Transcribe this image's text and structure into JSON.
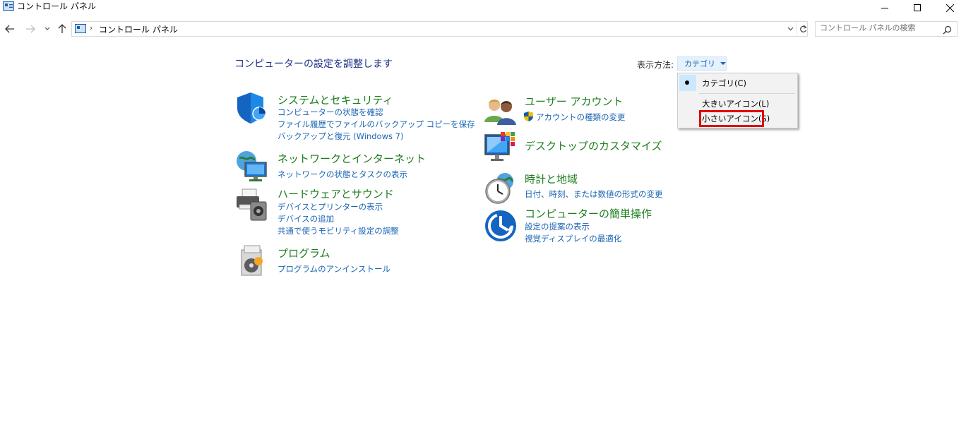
{
  "window": {
    "title": "コントロール パネル",
    "icons": {
      "app": "control-panel-icon",
      "minimize": "minimize-icon",
      "maximize": "maximize-icon",
      "close": "close-icon"
    }
  },
  "nav": {
    "icons": {
      "back": "back-arrow-icon",
      "forward": "forward-arrow-icon",
      "recent": "chevron-down-icon",
      "up": "up-arrow-icon",
      "refresh": "refresh-icon"
    },
    "address": {
      "separator": "›",
      "path": "コントロール パネル"
    },
    "search": {
      "placeholder": "コントロール パネルの検索",
      "icon": "search-icon"
    }
  },
  "main": {
    "title": "コンピューターの設定を調整します",
    "view_by": {
      "label": "表示方法:",
      "value": "カテゴリ"
    }
  },
  "categories": [
    {
      "title": "システムとセキュリティ",
      "icon": "security-shield-icon",
      "links": [
        "コンピューターの状態を確認",
        "ファイル履歴でファイルのバックアップ コピーを保存",
        "バックアップと復元 (Windows 7)"
      ]
    },
    {
      "title": "ネットワークとインターネット",
      "icon": "network-globe-icon",
      "links": [
        "ネットワークの状態とタスクの表示"
      ]
    },
    {
      "title": "ハードウェアとサウンド",
      "icon": "printer-speaker-icon",
      "links": [
        "デバイスとプリンターの表示",
        "デバイスの追加",
        "共通で使うモビリティ設定の調整"
      ]
    },
    {
      "title": "プログラム",
      "icon": "programs-disc-icon",
      "links": [
        "プログラムのアンインストール"
      ]
    },
    {
      "title": "ユーザー アカウント",
      "icon": "user-accounts-icon",
      "links": [
        "アカウントの種類の変更"
      ],
      "link_icon": "uac-shield-icon"
    },
    {
      "title": "デスクトップのカスタマイズ",
      "icon": "monitor-palette-icon",
      "links": []
    },
    {
      "title": "時計と地域",
      "icon": "clock-globe-icon",
      "links": [
        "日付、時刻、または数値の形式の変更"
      ]
    },
    {
      "title": "コンピューターの簡単操作",
      "icon": "ease-of-access-icon",
      "links": [
        "設定の提案の表示",
        "視覚ディスプレイの最適化"
      ]
    }
  ],
  "view_menu": {
    "items": [
      {
        "label": "カテゴリ(C)",
        "selected": true
      },
      {
        "label": "大きいアイコン(L)",
        "selected": false
      },
      {
        "label": "小さいアイコン(S)",
        "selected": false,
        "highlighted": true
      }
    ]
  },
  "colors": {
    "title_blue": "#1e3287",
    "category_green": "#1e7d1e",
    "link_blue": "#1a64b4",
    "highlight_red": "#e00000"
  }
}
